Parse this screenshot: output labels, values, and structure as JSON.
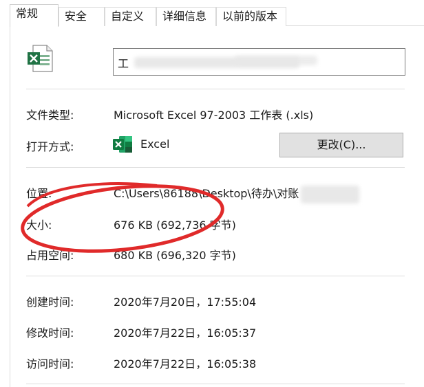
{
  "tabs": [
    {
      "label": "常规",
      "active": true
    },
    {
      "label": "安全",
      "active": false
    },
    {
      "label": "自定义",
      "active": false
    },
    {
      "label": "详细信息",
      "active": false
    },
    {
      "label": "以前的版本",
      "active": false
    }
  ],
  "file": {
    "name_visible": "工"
  },
  "rows": {
    "type": {
      "label": "文件类型:",
      "value": "Microsoft Excel 97-2003 工作表 (.xls)"
    },
    "open_with": {
      "label": "打开方式:",
      "app": "Excel",
      "button": "更改(C)..."
    },
    "location": {
      "label": "位置:",
      "value": "C:\\Users\\86188\\Desktop\\待办\\对账"
    },
    "size": {
      "label": "大小:",
      "value": "676 KB (692,736 字节)"
    },
    "size_on_disk": {
      "label": "占用空间:",
      "value": "680 KB (696,320 字节)"
    },
    "created": {
      "label": "创建时间:",
      "value": "2020年7月20日，17:55:04"
    },
    "modified": {
      "label": "修改时间:",
      "value": "2020年7月22日，16:05:37"
    },
    "accessed": {
      "label": "访问时间:",
      "value": "2020年7月22日，16:05:38"
    }
  },
  "colors": {
    "excel_green": "#1f7244",
    "annotation_red": "#e02a2a"
  },
  "icons": [
    "excel-file-icon",
    "excel-app-icon"
  ]
}
